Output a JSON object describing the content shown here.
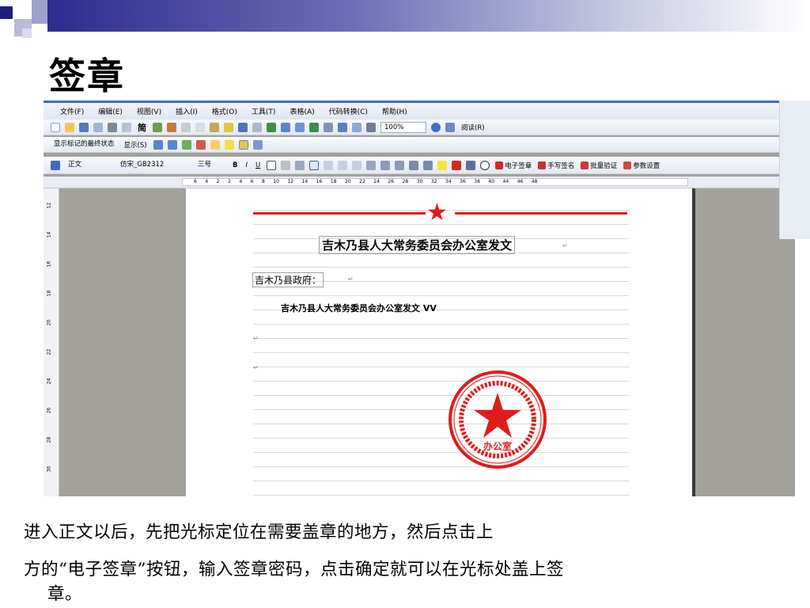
{
  "slide": {
    "title": "签章",
    "caption_line1": "进入正文以后，先把光标定位在需要盖章的地方，然后点击上",
    "caption_line2": "方的“电子签章”按钮，输入签章密码，点击确定就可以在光标处盖上签",
    "caption_line3": "章。"
  },
  "colors": {
    "accent": "#2b2d8f",
    "seal_red": "#e11b1b"
  },
  "menu": [
    "文件(F)",
    "编辑(E)",
    "视图(V)",
    "插入(I)",
    "格式(O)",
    "工具(T)",
    "表格(A)",
    "代码转换(C)",
    "帮助(H)"
  ],
  "toolbar1": {
    "jian_label": "简",
    "zoom": "100%",
    "read_label": "阅读(R)"
  },
  "toolbar2": {
    "markup_select": "显示标记的最终状态",
    "show_label": "显示(S)"
  },
  "toolbar3": {
    "style_select": "正文",
    "font_select": "仿宋_GB2312",
    "size_select": "三号",
    "bold": "B",
    "italic": "I",
    "underline": "U",
    "e_seal": "电子签章",
    "hand_sign": "手写签名",
    "batch_verify": "批量验证",
    "settings": "参数设置"
  },
  "ruler_h": [
    "6",
    "4",
    "2",
    "2",
    "4",
    "6",
    "8",
    "10",
    "12",
    "14",
    "16",
    "18",
    "20",
    "22",
    "24",
    "26",
    "28",
    "30",
    "32",
    "34",
    "36",
    "38",
    "40",
    "44",
    "46",
    "48"
  ],
  "ruler_v": [
    "12",
    "14",
    "16",
    "18",
    "20",
    "22",
    "24",
    "26",
    "28",
    "30"
  ],
  "document": {
    "title": "吉木乃县人大常务委员会办公室发文",
    "addressee": "吉木乃县政府：",
    "body": "吉木乃县人大常务委员会办公室发文 VV",
    "seal_bottom_text": "办公室"
  }
}
